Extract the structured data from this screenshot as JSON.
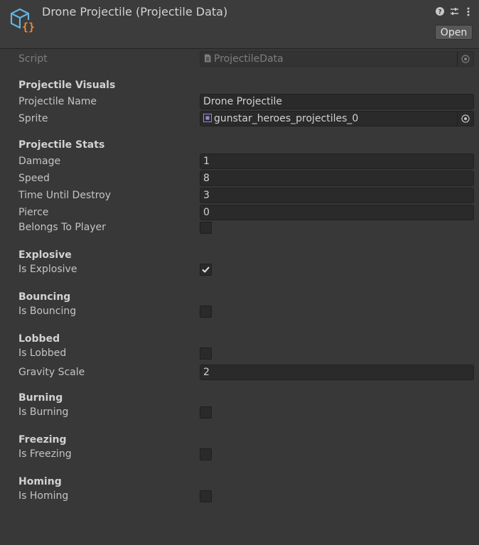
{
  "header": {
    "title": "Drone Projectile (Projectile Data)",
    "open_label": "Open",
    "icons": [
      "help-icon",
      "presets-icon",
      "more-icon"
    ],
    "accent": "#f08a33",
    "logo_color": "#63b3dd"
  },
  "script": {
    "label": "Script",
    "value": "ProjectileData"
  },
  "projectile_visuals": {
    "header": "Projectile Visuals",
    "name_label": "Projectile Name",
    "name_value": "Drone Projectile",
    "sprite_label": "Sprite",
    "sprite_value": "gunstar_heroes_projectiles_0"
  },
  "projectile_stats": {
    "header": "Projectile Stats",
    "damage_label": "Damage",
    "damage_value": "1",
    "speed_label": "Speed",
    "speed_value": "8",
    "time_label": "Time Until Destroy",
    "time_value": "3",
    "pierce_label": "Pierce",
    "pierce_value": "0",
    "belongs_label": "Belongs To Player",
    "belongs_checked": false
  },
  "explosive": {
    "header": "Explosive",
    "label": "Is Explosive",
    "checked": true
  },
  "bouncing": {
    "header": "Bouncing",
    "label": "Is Bouncing",
    "checked": false
  },
  "lobbed": {
    "header": "Lobbed",
    "label": "Is Lobbed",
    "checked": false,
    "gravity_label": "Gravity Scale",
    "gravity_value": "2"
  },
  "burning": {
    "header": "Burning",
    "label": "Is Burning",
    "checked": false
  },
  "freezing": {
    "header": "Freezing",
    "label": "Is Freezing",
    "checked": false
  },
  "homing": {
    "header": "Homing",
    "label": "Is Homing",
    "checked": false
  }
}
